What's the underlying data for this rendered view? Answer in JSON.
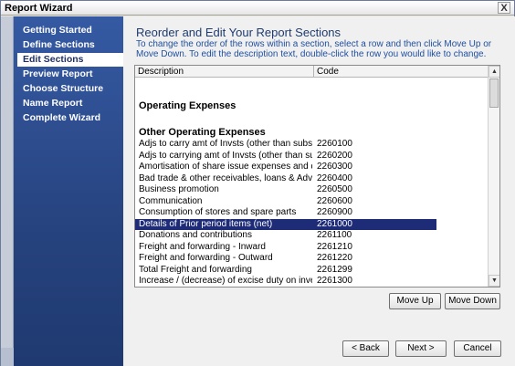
{
  "window": {
    "title": "Report Wizard",
    "close_glyph": "X"
  },
  "sidebar": {
    "steps": [
      {
        "label": "Getting Started"
      },
      {
        "label": "Define Sections"
      },
      {
        "label": "Edit Sections"
      },
      {
        "label": "Preview Report"
      },
      {
        "label": "Choose Structure"
      },
      {
        "label": "Name Report"
      },
      {
        "label": "Complete Wizard"
      }
    ]
  },
  "main": {
    "heading": "Reorder and Edit Your Report Sections",
    "description": "To change the order of the rows within a section, select a row and then click Move Up or Move Down. To edit the description text, double-click the row you would like to change.",
    "columns": {
      "description": "Description",
      "code": "Code"
    },
    "rows": [
      {
        "description": "Operating Expenses",
        "code": ""
      },
      {
        "description": "Other Operating Expenses",
        "code": ""
      },
      {
        "description": "Adjs to carry amt of Invsts (other than subsy) (net)-cu...",
        "code": "2260100"
      },
      {
        "description": "Adjs to carrying amt of Invsts (other than subsy) (net)-...",
        "code": "2260200"
      },
      {
        "description": "Amortisation of share issue expenses and discount o...",
        "code": "2260300"
      },
      {
        "description": "Bad trade & other receivables, loans & Advs written off",
        "code": "2260400"
      },
      {
        "description": "Business promotion",
        "code": "2260500"
      },
      {
        "description": "Communication",
        "code": "2260600"
      },
      {
        "description": "Consumption of stores and spare parts",
        "code": "2260900"
      },
      {
        "description": "Details of Prior period items (net)",
        "code": "2261000"
      },
      {
        "description": "Donations and contributions",
        "code": "2261100"
      },
      {
        "description": "Freight and forwarding - Inward",
        "code": "2261210"
      },
      {
        "description": "Freight and forwarding - Outward",
        "code": "2261220"
      },
      {
        "description": "Total Freight and forwarding",
        "code": "2261299"
      },
      {
        "description": "Increase / (decrease) of excise duty on inventory",
        "code": "2261300"
      }
    ]
  },
  "buttons": {
    "move_up": "Move Up",
    "move_down": "Move Down",
    "back": "< Back",
    "next": "Next >",
    "cancel": "Cancel"
  },
  "icons": {
    "scroll_up": "scroll-up-arrow-icon",
    "scroll_down": "scroll-down-arrow-icon",
    "close": "close-icon"
  }
}
